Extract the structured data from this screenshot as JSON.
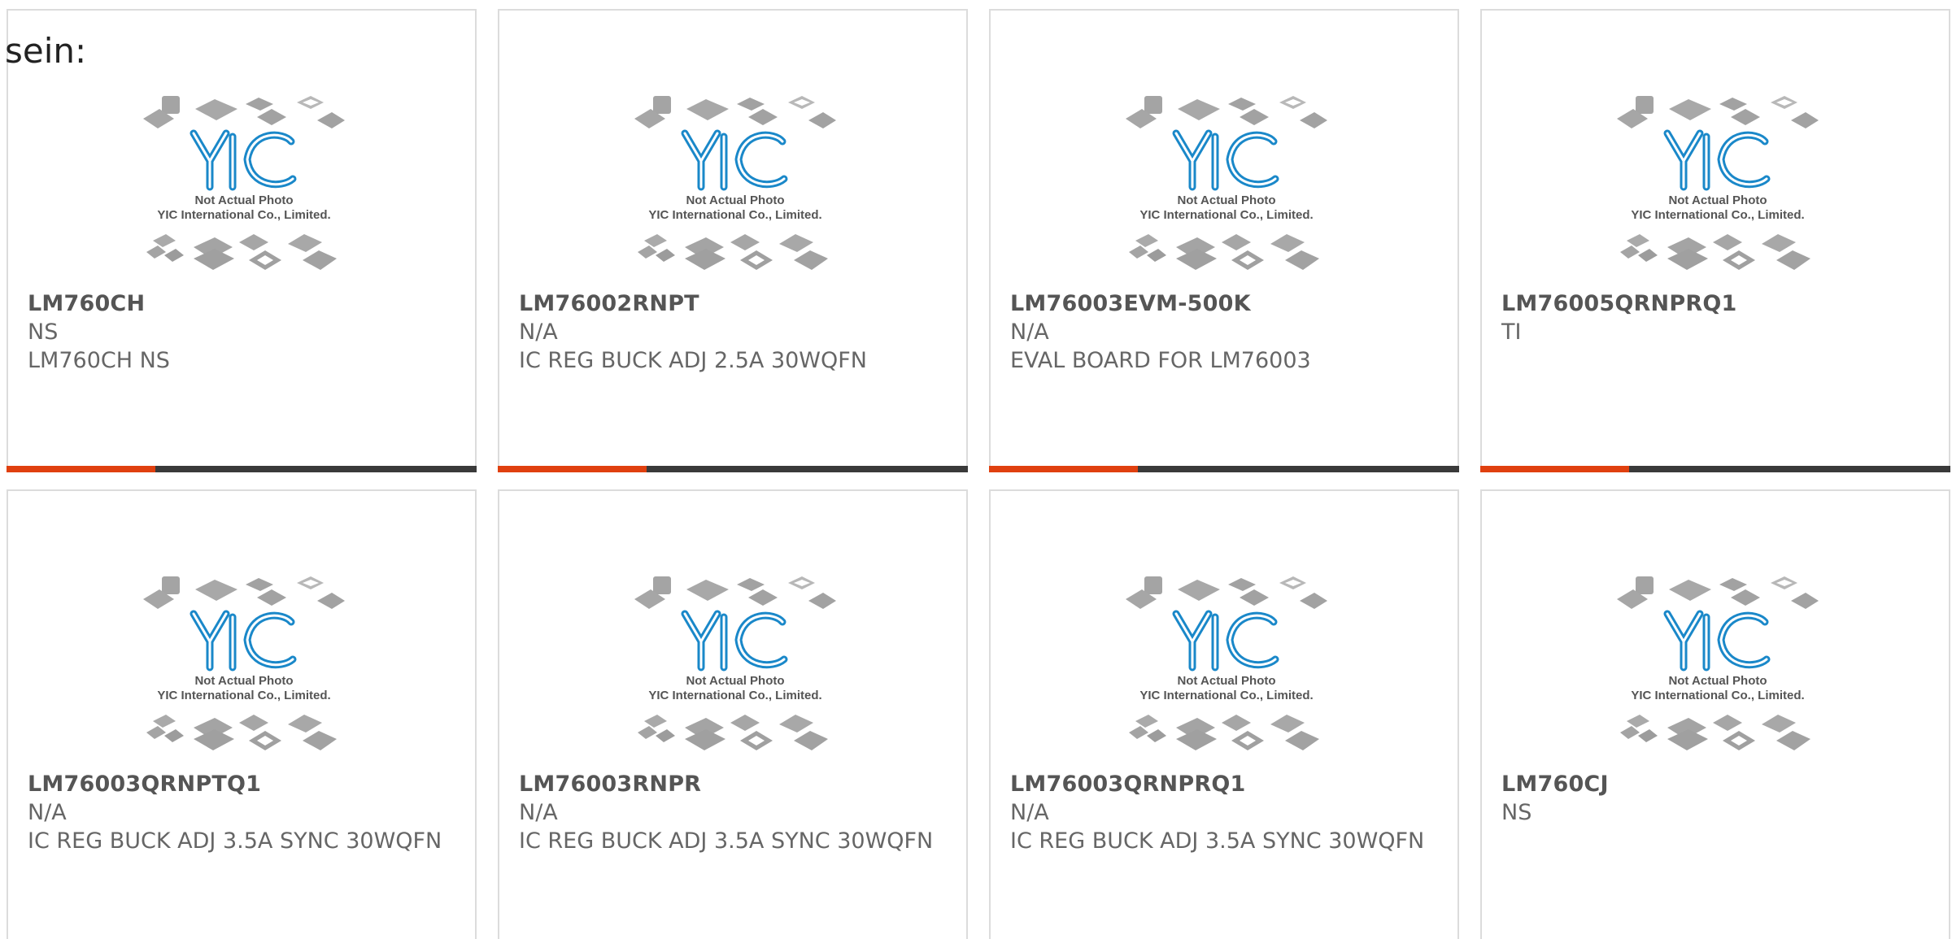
{
  "header": {
    "lead_text": "sein:"
  },
  "colors": {
    "accent": "#e0400f",
    "bar_dark": "#3a3a3a",
    "logo_blue": "#1a88c9",
    "chip_gray": "#9a9a9a"
  },
  "placeholder": {
    "line1": "Not Actual Photo",
    "line2": "YIC International Co., Limited."
  },
  "products": [
    {
      "part": "LM760CH",
      "mfr": "NS",
      "desc": "LM760CH NS",
      "has_bar": true
    },
    {
      "part": "LM76002RNPT",
      "mfr": "N/A",
      "desc": "IC REG BUCK ADJ 2.5A 30WQFN",
      "has_bar": true
    },
    {
      "part": "LM76003EVM-500K",
      "mfr": "N/A",
      "desc": "EVAL BOARD FOR LM76003",
      "has_bar": true
    },
    {
      "part": "LM76005QRNPRQ1",
      "mfr": "TI",
      "desc": "",
      "has_bar": true
    },
    {
      "part": "LM76003QRNPTQ1",
      "mfr": "N/A",
      "desc": "IC REG BUCK ADJ 3.5A SYNC 30WQFN",
      "has_bar": false
    },
    {
      "part": "LM76003RNPR",
      "mfr": "N/A",
      "desc": "IC REG BUCK ADJ 3.5A SYNC 30WQFN",
      "has_bar": false
    },
    {
      "part": "LM76003QRNPRQ1",
      "mfr": "N/A",
      "desc": "IC REG BUCK ADJ 3.5A SYNC 30WQFN",
      "has_bar": false
    },
    {
      "part": "LM760CJ",
      "mfr": "NS",
      "desc": "",
      "has_bar": false
    }
  ]
}
